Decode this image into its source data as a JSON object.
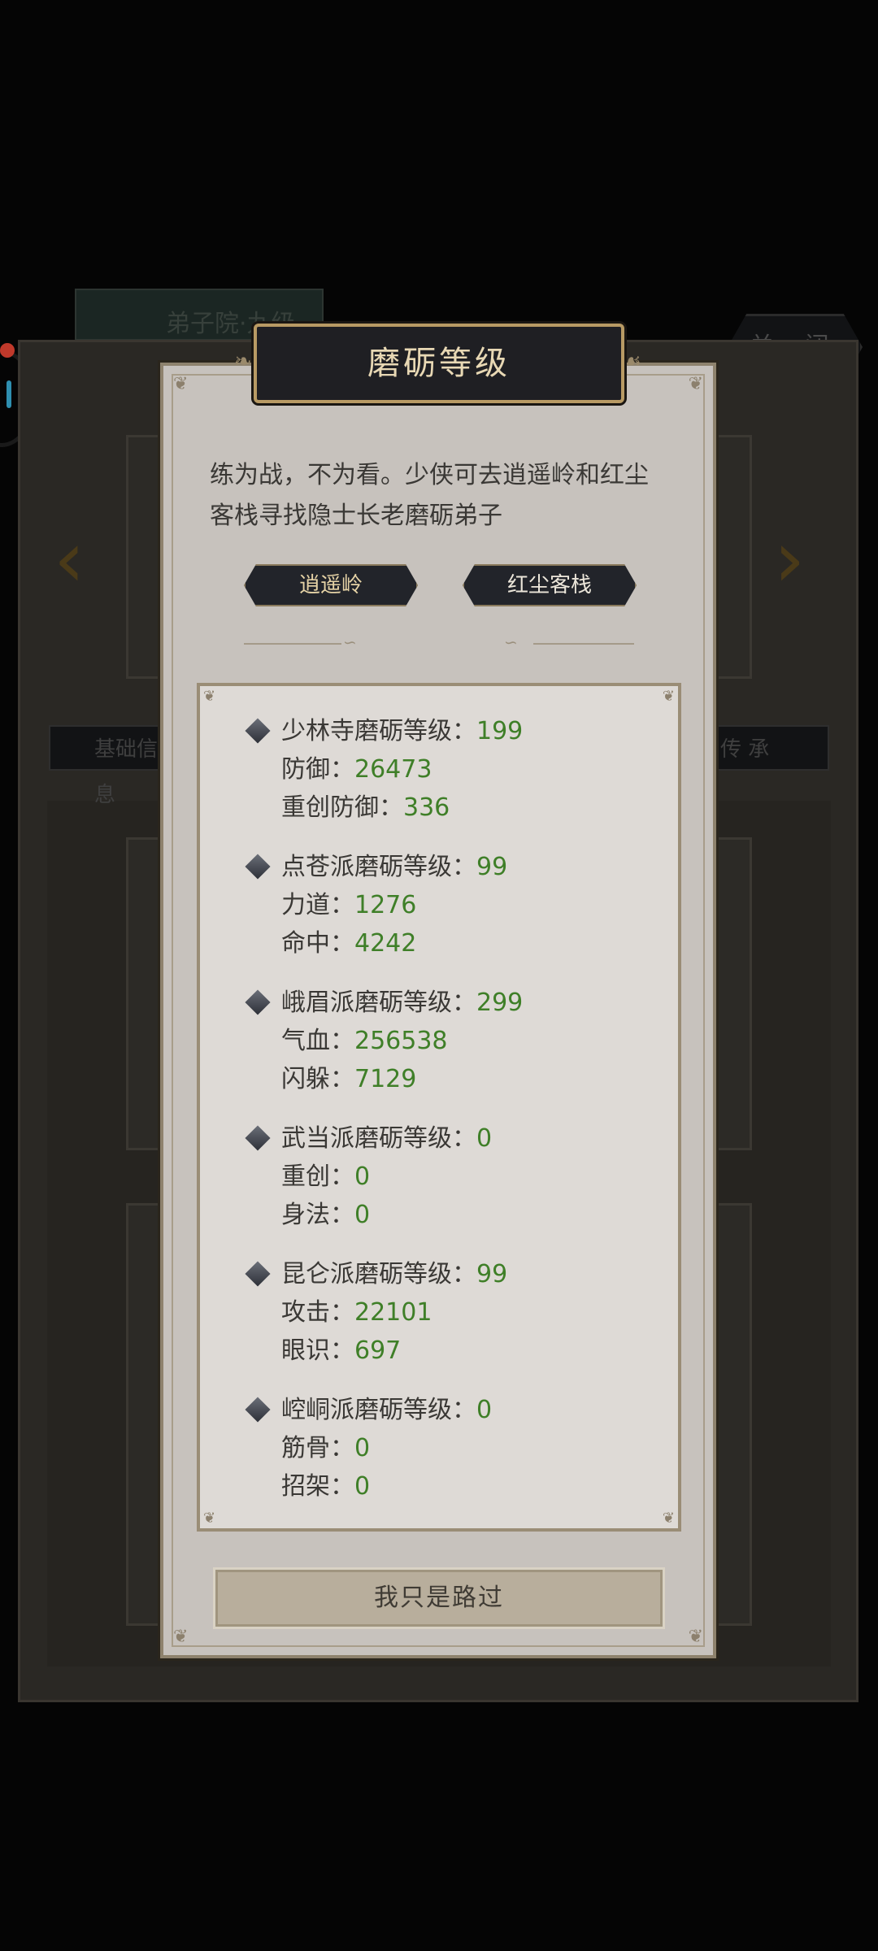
{
  "background": {
    "tab_label": "弟子院·九级",
    "close_label": "关 闭",
    "left_tab_label": "基础信息",
    "right_tab_label": "传 承"
  },
  "dialog": {
    "title": "磨砺等级",
    "description": "练为战，不为看。少侠可去逍遥岭和红尘客栈寻找隐士长老磨砺弟子",
    "location_buttons": [
      {
        "label": "逍遥岭"
      },
      {
        "label": "红尘客栈"
      }
    ],
    "entries": [
      {
        "title": "少林寺磨砺等级：",
        "level": "199",
        "stats": [
          {
            "label": "防御：",
            "value": "26473"
          },
          {
            "label": "重创防御：",
            "value": "336"
          }
        ]
      },
      {
        "title": "点苍派磨砺等级：",
        "level": "99",
        "stats": [
          {
            "label": "力道：",
            "value": "1276"
          },
          {
            "label": "命中：",
            "value": "4242"
          }
        ]
      },
      {
        "title": "峨眉派磨砺等级：",
        "level": "299",
        "stats": [
          {
            "label": "气血：",
            "value": "256538"
          },
          {
            "label": "闪躲：",
            "value": "7129"
          }
        ]
      },
      {
        "title": "武当派磨砺等级：",
        "level": "0",
        "stats": [
          {
            "label": "重创：",
            "value": "0"
          },
          {
            "label": "身法：",
            "value": "0"
          }
        ]
      },
      {
        "title": "昆仑派磨砺等级：",
        "level": "99",
        "stats": [
          {
            "label": "攻击：",
            "value": "22101"
          },
          {
            "label": "眼识：",
            "value": "697"
          }
        ]
      },
      {
        "title": "崆峒派磨砺等级：",
        "level": "0",
        "stats": [
          {
            "label": "筋骨：",
            "value": "0"
          },
          {
            "label": "招架：",
            "value": "0"
          }
        ]
      }
    ],
    "footer_button": "我只是路过"
  },
  "colors": {
    "value_green": "#3f7f28",
    "title_gold": "#e8d8b4",
    "dialog_bg": "#c7c2bd"
  }
}
